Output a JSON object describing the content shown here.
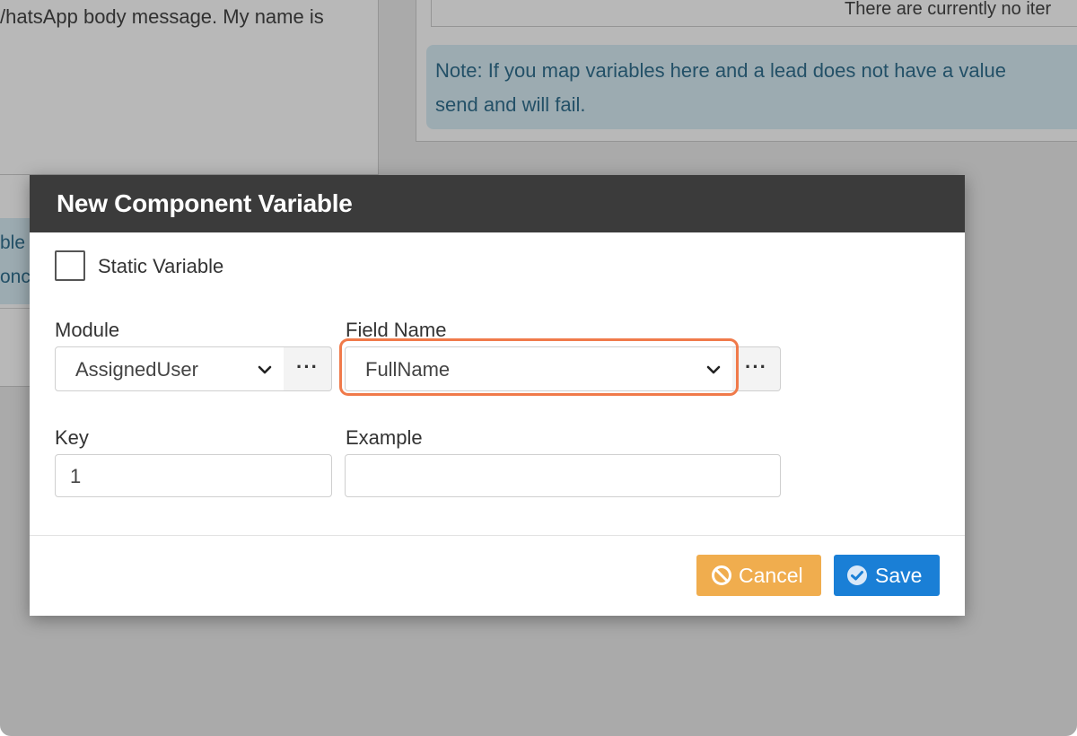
{
  "background": {
    "left_body_text": "/hatsApp body message. My name is",
    "left_info_line1": "ble",
    "left_info_line2": "onc",
    "right_empty_message": "There are currently no iter",
    "right_note_line1": "Note: If you map variables here and a lead does not have a value",
    "right_note_line2": "send and will fail."
  },
  "modal": {
    "title": "New Component Variable",
    "static_variable": {
      "label": "Static Variable",
      "checked": false
    },
    "module": {
      "label": "Module",
      "value": "AssignedUser",
      "more_label": "···"
    },
    "field_name": {
      "label": "Field Name",
      "value": "FullName",
      "more_label": "···"
    },
    "key": {
      "label": "Key",
      "value": "1"
    },
    "example": {
      "label": "Example",
      "value": ""
    },
    "buttons": {
      "cancel_label": "Cancel",
      "save_label": "Save"
    }
  },
  "colors": {
    "header_bg": "#3b3b3b",
    "cancel_bg": "#f0ad4e",
    "save_bg": "#1a7fd6",
    "highlight": "#f07a4a",
    "info_bg": "#d9eef6"
  }
}
